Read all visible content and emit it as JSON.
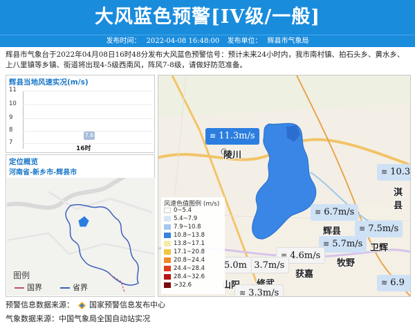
{
  "header": {
    "title": "大风蓝色预警[IV级/一般]",
    "publish_time_label": "发布时间：",
    "publish_time": "2022-04-08 16:48:00",
    "publisher_label": "发布单位：",
    "publisher": "辉县市气象局"
  },
  "description": "辉县市气象台于2022年04月08日16时48分发布大风蓝色预警信号：预计未来24小时内，我市南村镇、拍石头乡、黄水乡、上八里镇等乡镇、街道将出现4-5级西南风，阵风7-8级，请做好防范准备。",
  "wind_panel": {
    "title": "辉县当地风速实况(m/s)",
    "yticks": [
      "11",
      "10",
      "9",
      "8",
      "7"
    ],
    "bar_value": "7.6",
    "x_label": "16时"
  },
  "chart_data": {
    "type": "bar",
    "categories": [
      "16时"
    ],
    "values": [
      7.6
    ],
    "title": "辉县当地风速实况(m/s)",
    "ylim": [
      7,
      11
    ]
  },
  "location_panel": {
    "title": "定位概览",
    "region": "河南省-新乡市-辉县市",
    "legend_title": "图例",
    "legend": [
      {
        "label": "国界",
        "color": "#c0506e"
      },
      {
        "label": "省界",
        "color": "#3a5fb8"
      }
    ]
  },
  "main_map": {
    "cities": [
      "陵川",
      "淇县",
      "辉县",
      "卫辉",
      "牧野",
      "获嘉",
      "修武",
      "山阳"
    ],
    "tags": [
      {
        "value": "11.3m/s",
        "style": "blue"
      },
      {
        "value": "10.3",
        "style": "light"
      },
      {
        "value": "6.7m/s",
        "style": "light"
      },
      {
        "value": "7.5m/s",
        "style": "light"
      },
      {
        "value": "5.7m/s",
        "style": "light"
      },
      {
        "value": "4.6m/s",
        "style": "white"
      },
      {
        "value": "3.7m/s",
        "style": "white"
      },
      {
        "value": "5.0m",
        "style": "white"
      },
      {
        "value": "3.3m/s",
        "style": "white"
      },
      {
        "value": "6.9",
        "style": "light"
      }
    ],
    "legend_title": "风速色值图例 (m/s)",
    "legend": [
      {
        "label": "0~5.4",
        "color": "#ffffff"
      },
      {
        "label": "5.4~7.9",
        "color": "#d6e6f7"
      },
      {
        "label": "7.9~10.8",
        "color": "#a7c8ee"
      },
      {
        "label": "10.8~13.8",
        "color": "#3b82e0"
      },
      {
        "label": "13.8~17.1",
        "color": "#f7e9a8"
      },
      {
        "label": "17.1~20.8",
        "color": "#f5c542"
      },
      {
        "label": "20.8~24.4",
        "color": "#f08a2a"
      },
      {
        "label": "24.4~28.4",
        "color": "#e03b1c"
      },
      {
        "label": "28.4~32.6",
        "color": "#b51616"
      },
      {
        "label": ">32.6",
        "color": "#7a0b0b"
      }
    ]
  },
  "footer": {
    "warning_source": "预警信息数据来源：",
    "warning_source_name": "国家预警信息发布中心",
    "weather_source": "气象数据来源：中国气象局全国自动站实况"
  }
}
